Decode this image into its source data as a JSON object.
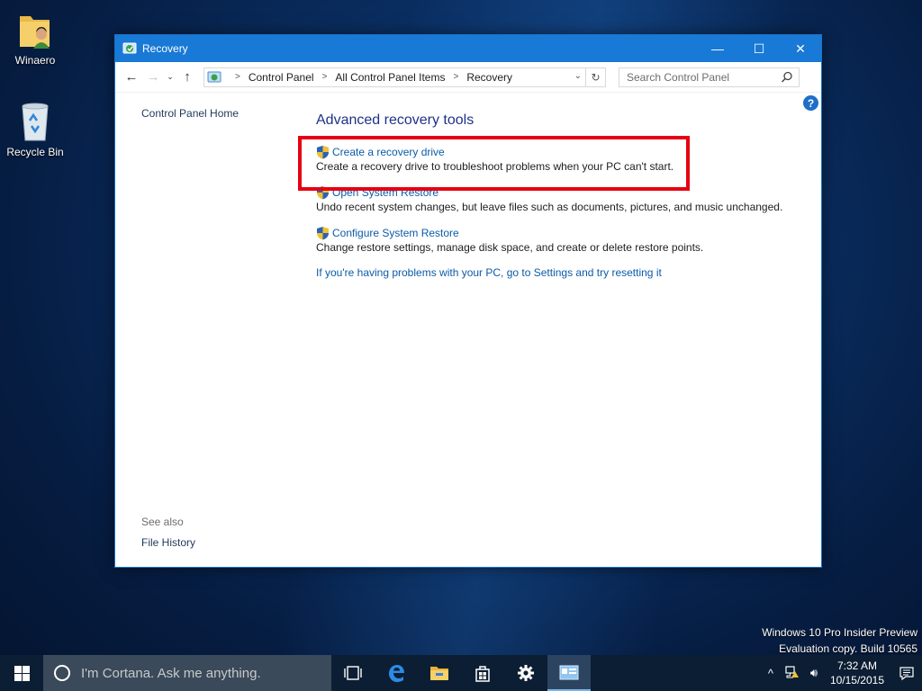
{
  "desktop": {
    "icons": [
      {
        "label": "Winaero",
        "icon": "user-folder-icon"
      },
      {
        "label": "Recycle Bin",
        "icon": "recycle-bin-icon"
      }
    ],
    "watermark_line1": "Windows 10 Pro Insider Preview",
    "watermark_line2": "Evaluation copy. Build 10565"
  },
  "window": {
    "title": "Recovery",
    "controls": {
      "minimize": "—",
      "maximize": "☐",
      "close": "✕"
    },
    "breadcrumb": [
      "Control Panel",
      "All Control Panel Items",
      "Recovery"
    ],
    "search_placeholder": "Search Control Panel",
    "left_pane": {
      "home_link": "Control Panel Home",
      "see_also_label": "See also",
      "see_also_items": [
        "File History"
      ]
    },
    "content": {
      "heading": "Advanced recovery tools",
      "tasks": [
        {
          "link": "Create a recovery drive",
          "description": "Create a recovery drive to troubleshoot problems when your PC can't start.",
          "icon": "uac-shield-icon"
        },
        {
          "link": "Open System Restore",
          "description": "Undo recent system changes, but leave files such as documents, pictures, and music unchanged.",
          "icon": "uac-shield-icon"
        },
        {
          "link": "Configure System Restore",
          "description": "Change restore settings, manage disk space, and create or delete restore points.",
          "icon": "uac-shield-icon"
        }
      ],
      "reset_link": "If you're having problems with your PC, go to Settings and try resetting it"
    },
    "highlight_color": "#e60012"
  },
  "taskbar": {
    "cortana_placeholder": "I'm Cortana. Ask me anything.",
    "pinned": [
      "task-view-icon",
      "edge-icon",
      "file-explorer-icon",
      "store-icon",
      "settings-icon",
      "control-panel-icon"
    ],
    "clock_time": "7:32 AM",
    "clock_date": "10/15/2015",
    "tray": [
      "chevron-up-icon",
      "network-icon",
      "volume-icon",
      "action-center-icon"
    ]
  },
  "colors": {
    "titlebar": "#1979d6",
    "link": "#0b5ba8",
    "heading": "#1e3287",
    "taskbar": "#0c1e33"
  }
}
